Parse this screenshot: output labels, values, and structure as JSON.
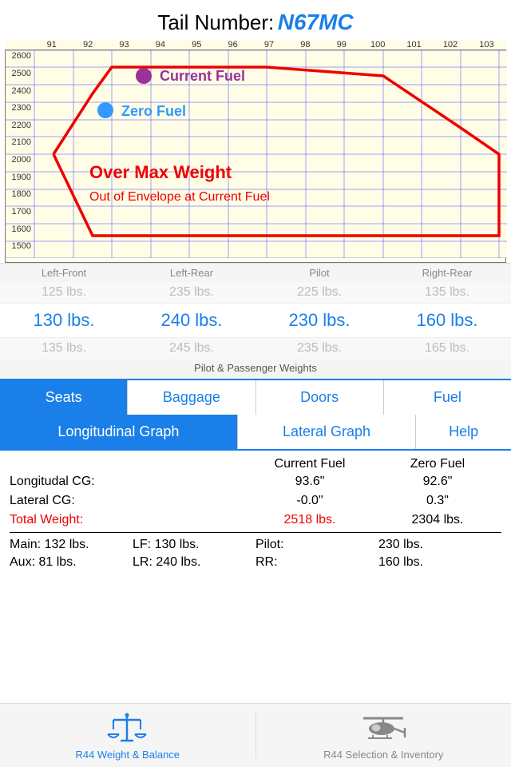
{
  "header": {
    "static_text": "Tail Number:",
    "tail_number": "N67MC"
  },
  "chart": {
    "x_labels": [
      "91",
      "92",
      "93",
      "94",
      "95",
      "96",
      "97",
      "98",
      "99",
      "100",
      "101",
      "102",
      "103"
    ],
    "y_labels": [
      "2600",
      "2500",
      "2400",
      "2300",
      "2200",
      "2100",
      "2000",
      "1900",
      "1800",
      "1700",
      "1600",
      "1500"
    ],
    "legend_current_fuel": "Current Fuel",
    "legend_zero_fuel": "Zero Fuel",
    "over_max_text": "Over Max Weight",
    "out_envelope_text": "Out of Envelope at Current Fuel"
  },
  "weights": {
    "labels": [
      "Left-Front",
      "Left-Rear",
      "Pilot",
      "Right-Rear"
    ],
    "row_top_gray": [
      "125 lbs.",
      "235 lbs.",
      "225 lbs.",
      "135 lbs."
    ],
    "row_main": [
      "130 lbs.",
      "240 lbs.",
      "230 lbs.",
      "160 lbs."
    ],
    "row_bot_gray": [
      "135 lbs.",
      "245 lbs.",
      "235 lbs.",
      "165 lbs."
    ],
    "caption": "Pilot & Passenger Weights"
  },
  "tabs_row1": {
    "tabs": [
      {
        "label": "Seats",
        "active": true
      },
      {
        "label": "Baggage",
        "active": false
      },
      {
        "label": "Doors",
        "active": false
      },
      {
        "label": "Fuel",
        "active": false
      }
    ]
  },
  "tabs_row2": {
    "tabs": [
      {
        "label": "Longitudinal Graph",
        "active": true
      },
      {
        "label": "Lateral Graph",
        "active": false
      },
      {
        "label": "Help",
        "active": false
      }
    ]
  },
  "cg": {
    "col_current": "Current Fuel",
    "col_zero": "Zero Fuel",
    "rows": [
      {
        "label": "Longitudal CG:",
        "v1": "93.6\"",
        "v2": "92.6\"",
        "red": false
      },
      {
        "label": "Lateral CG:",
        "v1": "-0.0\"",
        "v2": "0.3\"",
        "red": false
      },
      {
        "label": "Total Weight:",
        "v1": "2518 lbs.",
        "v2": "2304 lbs.",
        "red": true
      }
    ]
  },
  "details": {
    "row1": {
      "c1": "Main: 132 lbs.",
      "c2": "LF: 130 lbs.",
      "c3": "Pilot:",
      "c4": "230 lbs."
    },
    "row2": {
      "c1": "Aux:   81 lbs.",
      "c2": "LR: 240 lbs.",
      "c3": "RR:",
      "c4": "160 lbs."
    }
  },
  "bottom_nav": {
    "item1_label": "R44 Weight & Balance",
    "item2_label": "R44 Selection & Inventory"
  }
}
